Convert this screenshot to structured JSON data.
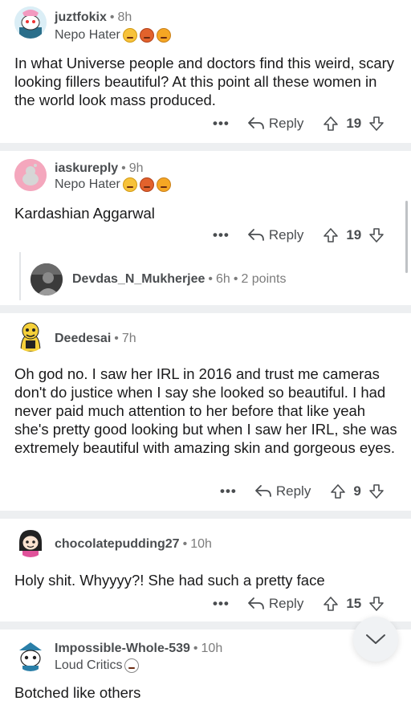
{
  "comments": [
    {
      "user": "juztfokix",
      "time": "8h",
      "flair": "Nepo Hater",
      "text": "In what Universe people and doctors find this weird, scary looking fillers beautiful? At this point all these women in the world look mass produced.",
      "reply_label": "Reply",
      "votes": "19"
    },
    {
      "user": "iaskureply",
      "time": "9h",
      "flair": "Nepo Hater",
      "text": "Kardashian Aggarwal",
      "reply_label": "Reply",
      "votes": "19",
      "sub_reply": {
        "user": "Devdas_N_Mukherjee",
        "time": "6h",
        "points": "2 points"
      }
    },
    {
      "user": "Deedesai",
      "time": "7h",
      "text": "Oh god no. I saw her IRL in 2016 and trust me cameras don't do justice when I say she looked so beautiful. I had never paid much attention to her before that like yeah she's pretty good looking but when I saw her IRL, she was extremely beautiful with amazing skin and gorgeous eyes.",
      "reply_label": "Reply",
      "votes": "9"
    },
    {
      "user": "chocolatepudding27",
      "time": "10h",
      "text": "Holy shit. Whyyyy?! She had such a pretty face",
      "reply_label": "Reply",
      "votes": "15"
    },
    {
      "user": "Impossible-Whole-539",
      "time": "10h",
      "flair": "Loud Critics",
      "text": "Botched like others"
    }
  ],
  "more_label": "•••",
  "dot": "•",
  "colors": {
    "separator": "#edeff1",
    "meta": "#7c7c7c",
    "action": "#4a4d50"
  }
}
